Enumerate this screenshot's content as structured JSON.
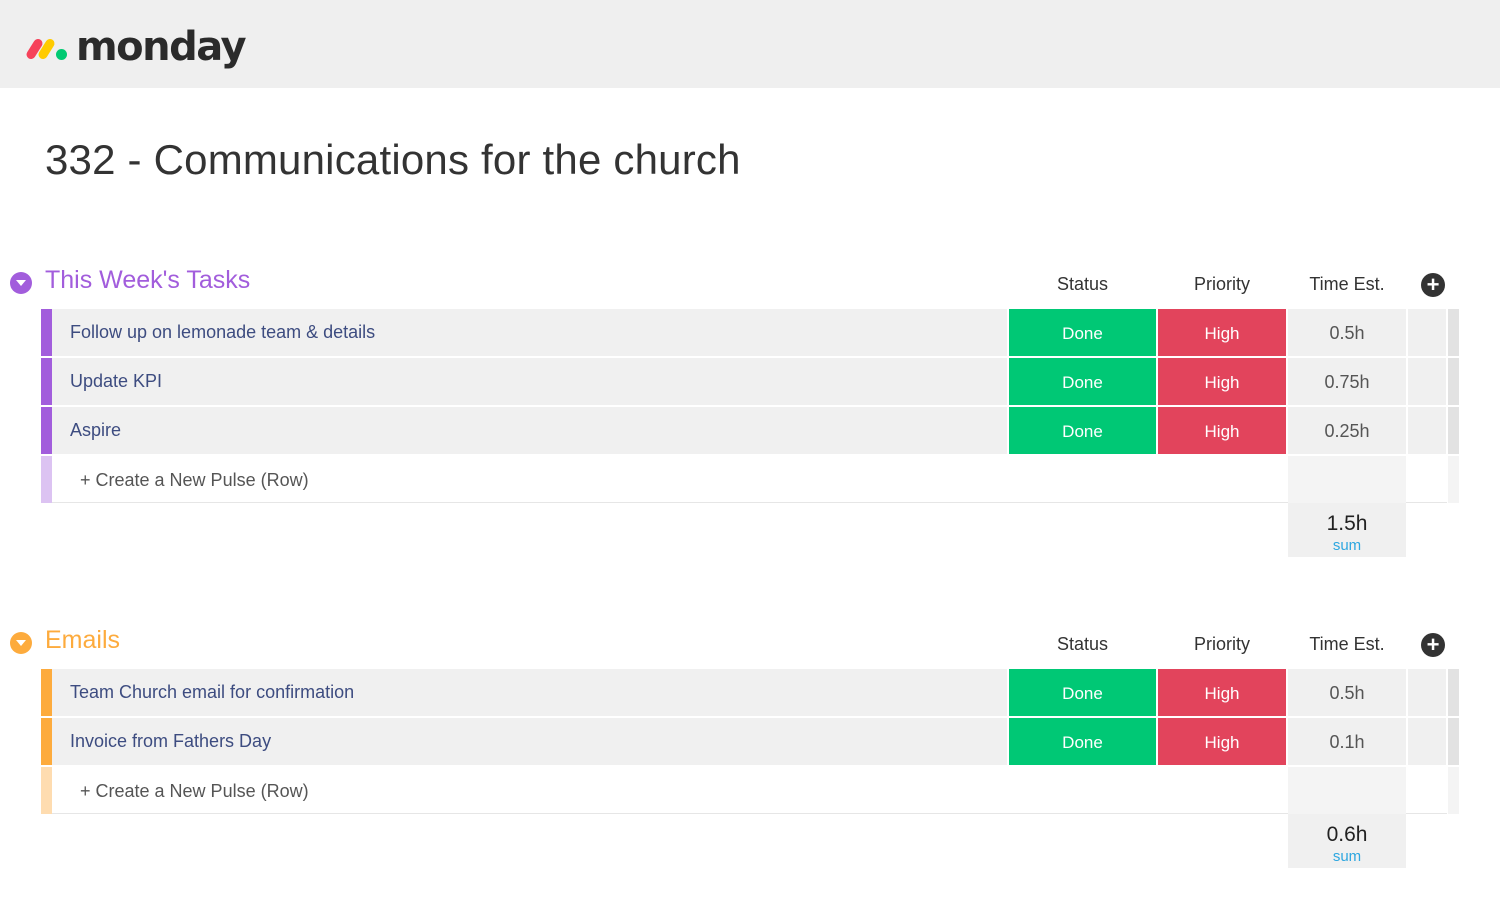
{
  "app": {
    "logo_text": "monday"
  },
  "page": {
    "title": "332 - Communications for the church"
  },
  "columns": {
    "status": "Status",
    "priority": "Priority",
    "time": "Time Est."
  },
  "add_column_icon": "plus-circle-icon",
  "groups": [
    {
      "title": "This Week's Tasks",
      "color": "#a25ddc",
      "light_color": "#dcc3f2",
      "rows": [
        {
          "name": "Follow up on lemonade team & details",
          "status": "Done",
          "priority": "High",
          "time": "0.5h"
        },
        {
          "name": "Update KPI",
          "status": "Done",
          "priority": "High",
          "time": "0.75h"
        },
        {
          "name": "Aspire",
          "status": "Done",
          "priority": "High",
          "time": "0.25h"
        }
      ],
      "new_row_label": "+ Create a New Pulse (Row)",
      "sum": {
        "value": "1.5h",
        "label": "sum"
      }
    },
    {
      "title": "Emails",
      "color": "#fdab3d",
      "light_color": "#fedcb0",
      "rows": [
        {
          "name": "Team Church email for confirmation",
          "status": "Done",
          "priority": "High",
          "time": "0.5h"
        },
        {
          "name": "Invoice from Fathers Day",
          "status": "Done",
          "priority": "High",
          "time": "0.1h"
        }
      ],
      "new_row_label": "+ Create a New Pulse (Row)",
      "sum": {
        "value": "0.6h",
        "label": "sum"
      }
    }
  ],
  "colors": {
    "status_done": "#00c875",
    "priority_high": "#e2445c",
    "sum_label": "#2ea7e0"
  }
}
